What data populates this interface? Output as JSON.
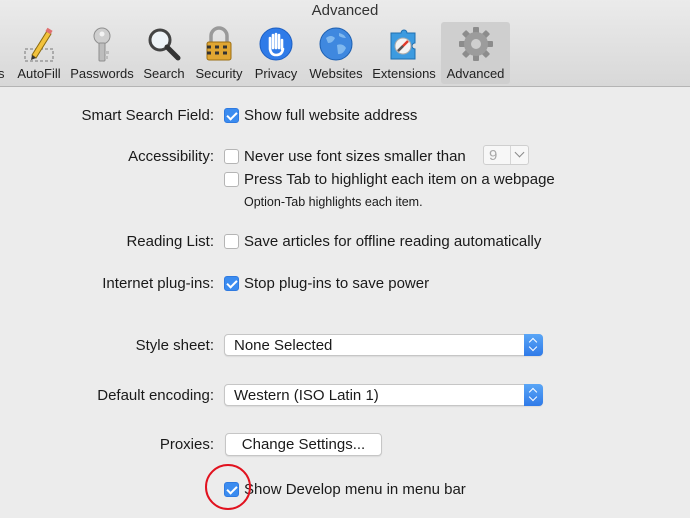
{
  "window": {
    "title": "Advanced"
  },
  "toolbar": {
    "items": [
      {
        "label": "s",
        "icon": "general-icon"
      },
      {
        "label": "AutoFill",
        "icon": "pencil-icon"
      },
      {
        "label": "Passwords",
        "icon": "key-icon"
      },
      {
        "label": "Search",
        "icon": "magnifier-icon"
      },
      {
        "label": "Security",
        "icon": "lock-icon"
      },
      {
        "label": "Privacy",
        "icon": "hand-icon"
      },
      {
        "label": "Websites",
        "icon": "globe-icon"
      },
      {
        "label": "Extensions",
        "icon": "puzzle-icon"
      },
      {
        "label": "Advanced",
        "icon": "gear-icon",
        "selected": true
      }
    ]
  },
  "settings": {
    "smart_search": {
      "label": "Smart Search Field:",
      "option": "Show full website address",
      "checked": true
    },
    "accessibility": {
      "label": "Accessibility:",
      "font_size_option": "Never use font sizes smaller than",
      "font_size_checked": false,
      "font_size_value": "9",
      "tab_option": "Press Tab to highlight each item on a webpage",
      "tab_checked": false,
      "hint": "Option-Tab highlights each item."
    },
    "reading_list": {
      "label": "Reading List:",
      "option": "Save articles for offline reading automatically",
      "checked": false
    },
    "plugins": {
      "label": "Internet plug-ins:",
      "option": "Stop plug-ins to save power",
      "checked": true
    },
    "style_sheet": {
      "label": "Style sheet:",
      "value": "None Selected"
    },
    "encoding": {
      "label": "Default encoding:",
      "value": "Western (ISO Latin 1)"
    },
    "proxies": {
      "label": "Proxies:",
      "button": "Change Settings..."
    },
    "develop": {
      "option": "Show Develop menu in menu bar",
      "checked": true
    }
  },
  "colors": {
    "accent": "#3b8cf0",
    "annotation": "#e1121f"
  }
}
